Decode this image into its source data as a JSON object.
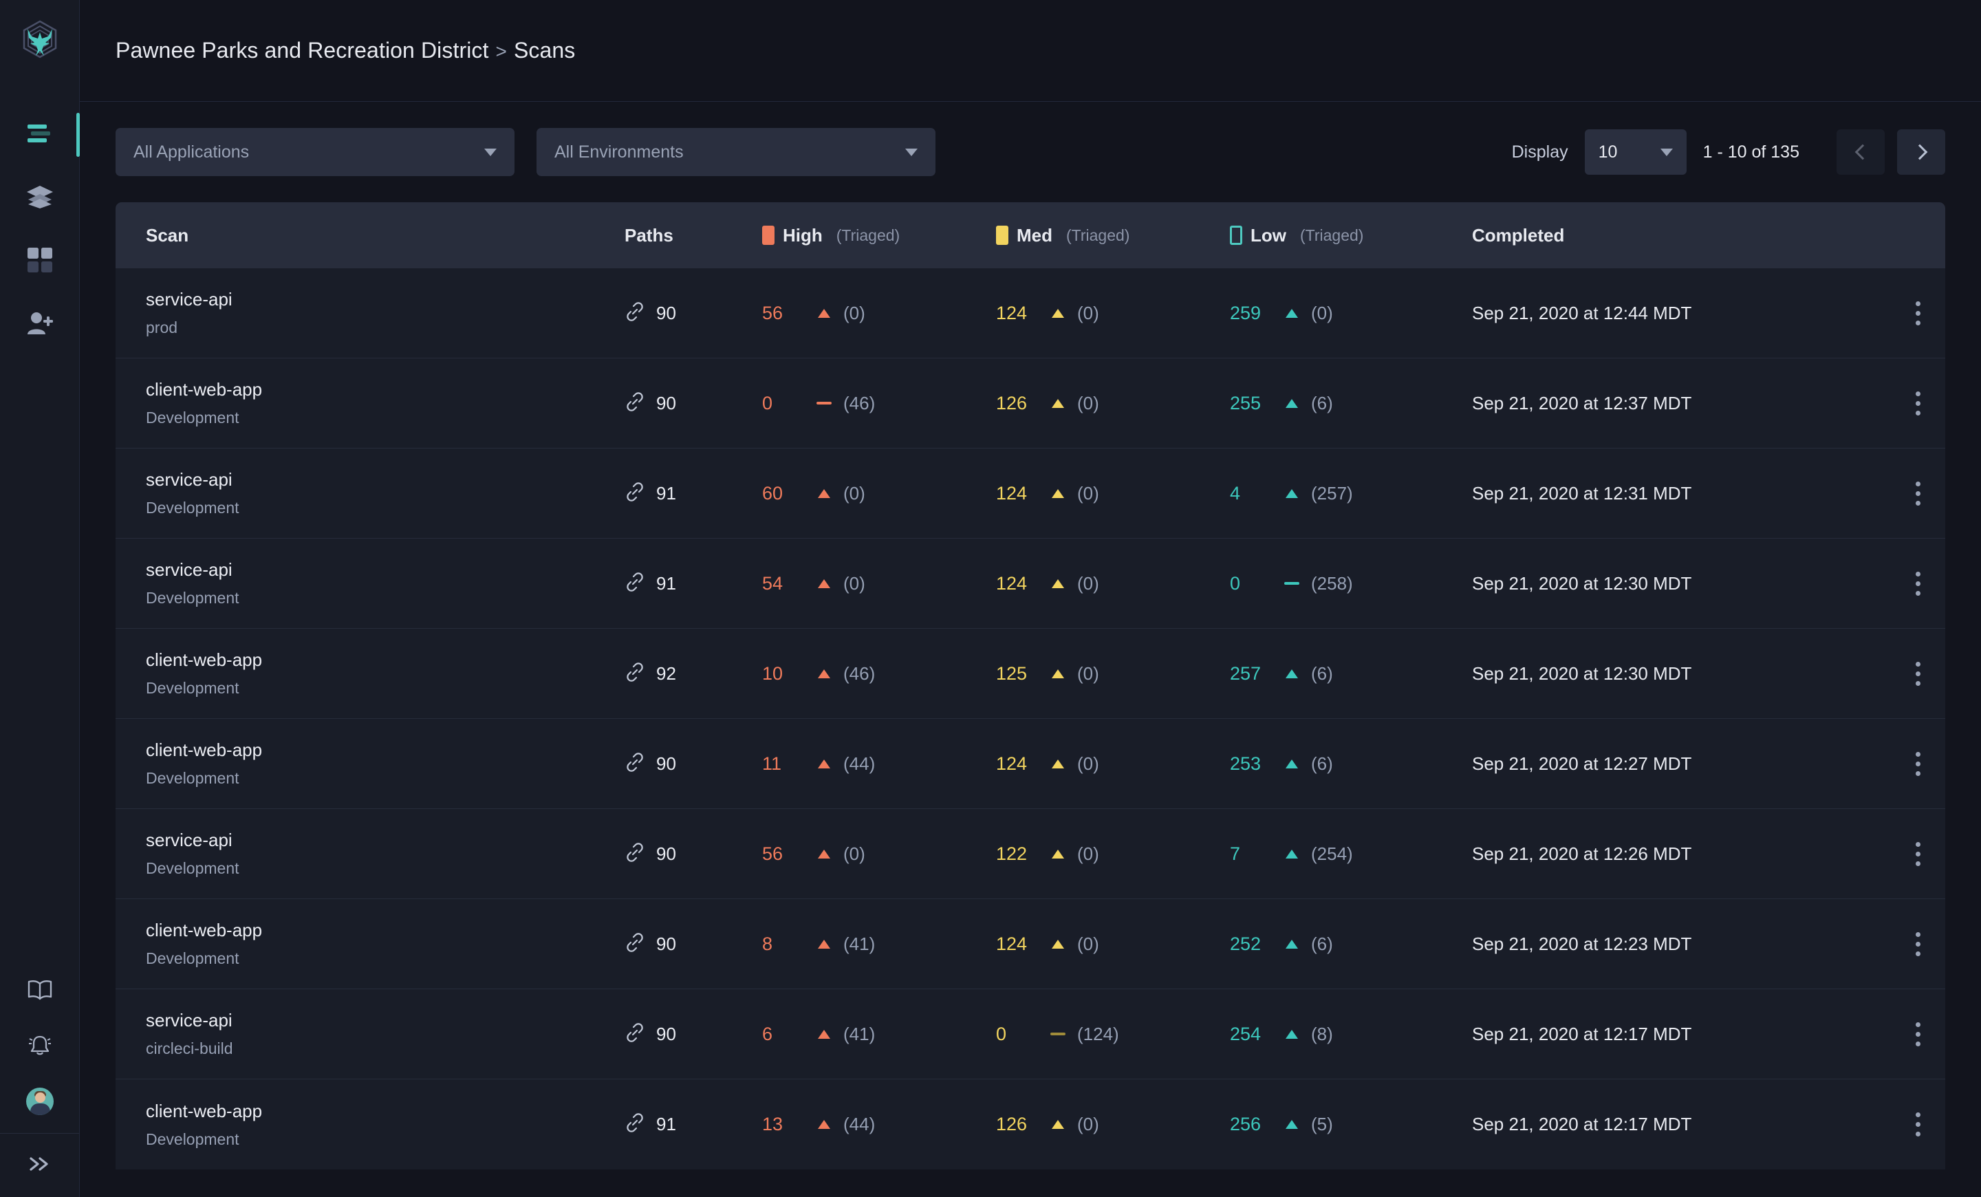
{
  "sidebar": {
    "logo_name": "phoenix-logo",
    "items": [
      {
        "icon": "menu-list-icon",
        "name": "scans",
        "active": true
      },
      {
        "icon": "layers-icon",
        "name": "applications",
        "active": false
      },
      {
        "icon": "grid-icon",
        "name": "dashboard",
        "active": false
      },
      {
        "icon": "add-user-icon",
        "name": "users",
        "active": false
      }
    ],
    "bottom_items": [
      {
        "icon": "book-icon",
        "name": "documentation"
      },
      {
        "icon": "bell-icon",
        "name": "notifications"
      },
      {
        "icon": "avatar",
        "name": "user-profile"
      }
    ],
    "collapse_icon": "double-chevron-right-icon"
  },
  "header": {
    "org": "Pawnee Parks and Recreation District",
    "separator": ">",
    "page": "Scans"
  },
  "toolbar": {
    "application_filter": "All Applications",
    "environment_filter": "All Environments",
    "display_label": "Display",
    "page_size": "10",
    "page_range": "1 - 10 of 135"
  },
  "table": {
    "columns": {
      "scan": "Scan",
      "paths": "Paths",
      "high": "High",
      "med": "Med",
      "low": "Low",
      "triaged": "(Triaged)",
      "completed": "Completed"
    },
    "colors": {
      "high": "#ef7b5b",
      "med": "#f2d45f",
      "low": "#4ec9c0",
      "accent": "#4ec9c0"
    },
    "rows": [
      {
        "name": "service-api",
        "env": "prod",
        "paths": "90",
        "high": "56",
        "high_trend": "up",
        "high_triaged": "(0)",
        "med": "124",
        "med_trend": "up",
        "med_triaged": "(0)",
        "low": "259",
        "low_trend": "up",
        "low_triaged": "(0)",
        "completed": "Sep 21, 2020 at 12:44 MDT"
      },
      {
        "name": "client-web-app",
        "env": "Development",
        "paths": "90",
        "high": "0",
        "high_trend": "flat",
        "high_triaged": "(46)",
        "med": "126",
        "med_trend": "up",
        "med_triaged": "(0)",
        "low": "255",
        "low_trend": "up",
        "low_triaged": "(6)",
        "completed": "Sep 21, 2020 at 12:37 MDT"
      },
      {
        "name": "service-api",
        "env": "Development",
        "paths": "91",
        "high": "60",
        "high_trend": "up",
        "high_triaged": "(0)",
        "med": "124",
        "med_trend": "up",
        "med_triaged": "(0)",
        "low": "4",
        "low_trend": "up",
        "low_triaged": "(257)",
        "completed": "Sep 21, 2020 at 12:31 MDT"
      },
      {
        "name": "service-api",
        "env": "Development",
        "paths": "91",
        "high": "54",
        "high_trend": "up",
        "high_triaged": "(0)",
        "med": "124",
        "med_trend": "up",
        "med_triaged": "(0)",
        "low": "0",
        "low_trend": "flat",
        "low_triaged": "(258)",
        "completed": "Sep 21, 2020 at 12:30 MDT"
      },
      {
        "name": "client-web-app",
        "env": "Development",
        "paths": "92",
        "high": "10",
        "high_trend": "up",
        "high_triaged": "(46)",
        "med": "125",
        "med_trend": "up",
        "med_triaged": "(0)",
        "low": "257",
        "low_trend": "up",
        "low_triaged": "(6)",
        "completed": "Sep 21, 2020 at 12:30 MDT"
      },
      {
        "name": "client-web-app",
        "env": "Development",
        "paths": "90",
        "high": "11",
        "high_trend": "up",
        "high_triaged": "(44)",
        "med": "124",
        "med_trend": "up",
        "med_triaged": "(0)",
        "low": "253",
        "low_trend": "up",
        "low_triaged": "(6)",
        "completed": "Sep 21, 2020 at 12:27 MDT"
      },
      {
        "name": "service-api",
        "env": "Development",
        "paths": "90",
        "high": "56",
        "high_trend": "up",
        "high_triaged": "(0)",
        "med": "122",
        "med_trend": "up",
        "med_triaged": "(0)",
        "low": "7",
        "low_trend": "up",
        "low_triaged": "(254)",
        "completed": "Sep 21, 2020 at 12:26 MDT"
      },
      {
        "name": "client-web-app",
        "env": "Development",
        "paths": "90",
        "high": "8",
        "high_trend": "up",
        "high_triaged": "(41)",
        "med": "124",
        "med_trend": "up",
        "med_triaged": "(0)",
        "low": "252",
        "low_trend": "up",
        "low_triaged": "(6)",
        "completed": "Sep 21, 2020 at 12:23 MDT"
      },
      {
        "name": "service-api",
        "env": "circleci-build",
        "paths": "90",
        "high": "6",
        "high_trend": "up",
        "high_triaged": "(41)",
        "med": "0",
        "med_trend": "flat",
        "med_triaged": "(124)",
        "low": "254",
        "low_trend": "up",
        "low_triaged": "(8)",
        "completed": "Sep 21, 2020 at 12:17 MDT"
      },
      {
        "name": "client-web-app",
        "env": "Development",
        "paths": "91",
        "high": "13",
        "high_trend": "up",
        "high_triaged": "(44)",
        "med": "126",
        "med_trend": "up",
        "med_triaged": "(0)",
        "low": "256",
        "low_trend": "up",
        "low_triaged": "(5)",
        "completed": "Sep 21, 2020 at 12:17 MDT"
      }
    ]
  }
}
